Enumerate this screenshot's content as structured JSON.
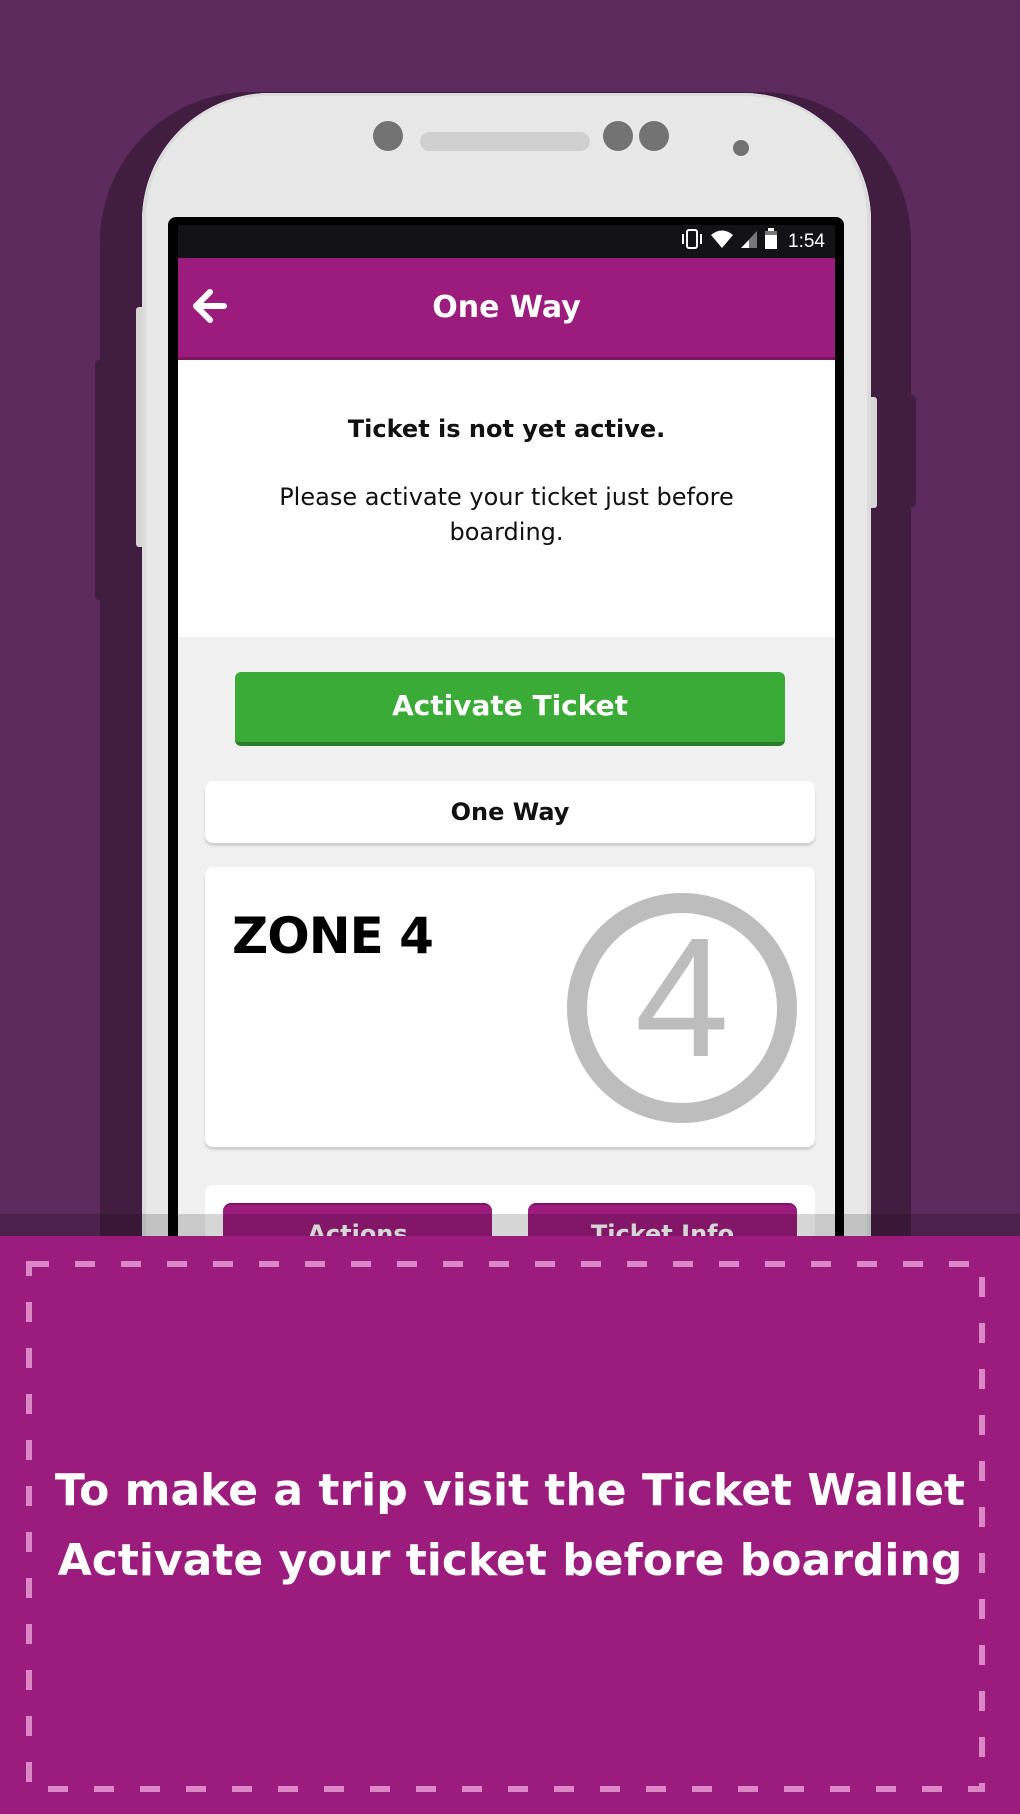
{
  "status_bar": {
    "icons": [
      "vibrate-icon",
      "wifi-icon",
      "cell-signal-icon",
      "battery-icon"
    ],
    "battery_level": "79",
    "time": "1:54"
  },
  "app_bar": {
    "back_icon": "arrow-left-icon",
    "title": "One Way"
  },
  "info": {
    "title": "Ticket is not yet active.",
    "message": "Please activate your ticket just before boarding."
  },
  "activate_button": {
    "label": "Activate Ticket"
  },
  "ticket": {
    "type": "One Way",
    "zone_label": "ZONE 4",
    "zone_number": "4"
  },
  "actions": [
    {
      "label": "Actions"
    },
    {
      "label": "Ticket Info"
    }
  ],
  "banner": {
    "line1": "To make a trip visit the Ticket Wallet",
    "line2": "Activate your ticket before boarding"
  },
  "colors": {
    "background": "#5c2a5c",
    "brand_purple": "#9b1c7c",
    "activate_green": "#3bab38",
    "zone_badge_gray": "#bdbdbd"
  }
}
